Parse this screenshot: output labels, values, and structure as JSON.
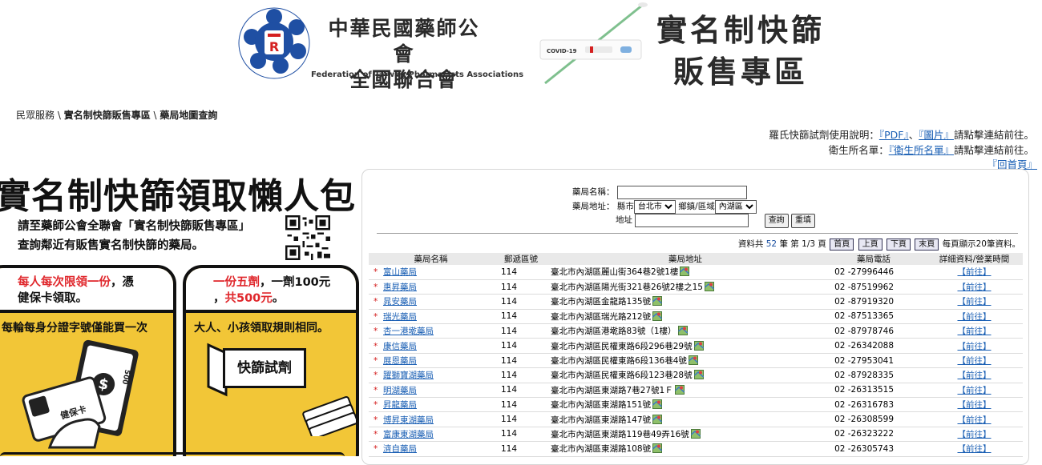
{
  "header": {
    "org_name_zh_line1": "中華民國藥師公會",
    "org_name_zh_line2": "全國聯合會",
    "org_name_en": "Federation of Taiwan Pharmacists Associations",
    "logo_ring_text": "Federation of Taiwan Pharmacists Associations",
    "swab_label": "COVID-19",
    "banner_line1": "實名制快篩",
    "banner_line2": "販售專區"
  },
  "breadcrumb": {
    "item1": "民眾服務",
    "sep": " \\ ",
    "item2": "實名制快篩販售專區",
    "item3": "藥局地圖查詢"
  },
  "info": {
    "line1_prefix": "羅氏快篩試劑使用說明：",
    "pdf_link": "『PDF』",
    "comma": "、",
    "image_link": "『圖片』",
    "line1_suffix": "請點擊連結前往。",
    "line2_prefix": "衛生所名單：",
    "clinic_link": "『衛生所名單』",
    "line2_suffix": "請點擊連結前往。",
    "home_link": "『回首頁』"
  },
  "promo": {
    "title": "實名制快篩領取懶人包",
    "desc_line1": "請至藥師公會全聯會「實名制快篩販售專區」",
    "desc_line2": "查詢鄰近有販售實名制快篩的藥局。",
    "card1_head_red": "每人每次限領一份",
    "card1_head_rest1": "，憑",
    "card1_head_line2": "健保卡領取。",
    "card1_sub": "每輪每身分證字號僅能買一次",
    "card2_head_red": "一份五劑",
    "card2_head_rest": "，一劑100元",
    "card2_head_line2_prefix": "，",
    "card2_head_line2_red": "共500元",
    "card2_head_line2_suffix": "。",
    "card2_sub": "大人、小孩領取規則相同。",
    "kit_label": "快篩試劑",
    "card_label": "健保卡",
    "bill_value": "500"
  },
  "search": {
    "name_label": "藥局名稱：",
    "name_value": "",
    "addr_label": "藥局地址：",
    "county_label": "縣市",
    "county_value": "台北市",
    "district_label": "鄉鎮/區域",
    "district_value": "內湖區",
    "street_label": "地址",
    "street_value": "",
    "query_btn": "查詢",
    "reset_btn": "重填"
  },
  "pager": {
    "prefix": "資料共",
    "total": "52",
    "unit": "筆 第",
    "page": "1/3",
    "page_unit": "頁",
    "first": "首頁",
    "prev": "上頁",
    "next": "下頁",
    "last": "末頁",
    "per_page_text": "每頁顯示20筆資料。"
  },
  "table": {
    "headers": [
      "藥局名稱",
      "郵遞區號",
      "藥局地址",
      "藥局電話",
      "詳細資料/營業時間"
    ],
    "detail_label": "【前往】",
    "rows": [
      {
        "name": "富山藥局",
        "zip": "114",
        "address": "臺北市內湖區麗山街364巷2號1樓",
        "phone": "02 -27996446"
      },
      {
        "name": "惠昇藥局",
        "zip": "114",
        "address": "臺北市內湖區陽光街321巷26號2樓之15",
        "phone": "02 -87519962"
      },
      {
        "name": "晁安藥局",
        "zip": "114",
        "address": "臺北市內湖區金龍路135號",
        "phone": "02 -87919320"
      },
      {
        "name": "瑞光藥局",
        "zip": "114",
        "address": "臺北市內湖區瑞光路212號",
        "phone": "02 -87513365"
      },
      {
        "name": "杏一港墘藥局",
        "zip": "114",
        "address": "臺北市內湖區港墘路83號（1樓）",
        "phone": "02 -87978746"
      },
      {
        "name": "康信藥局",
        "zip": "114",
        "address": "臺北市內湖區民權東路6段296巷29號",
        "phone": "02 -26342088"
      },
      {
        "name": "展恩藥局",
        "zip": "114",
        "address": "臺北市內湖區民權東路6段136巷4號",
        "phone": "02 -27953041"
      },
      {
        "name": "躍獅寶湖藥局",
        "zip": "114",
        "address": "臺北市內湖區民權東路6段123巷28號",
        "phone": "02 -87928335"
      },
      {
        "name": "明湖藥局",
        "zip": "114",
        "address": "臺北市內湖區東湖路7巷27號1Ｆ",
        "phone": "02 -26313515"
      },
      {
        "name": "昇龍藥局",
        "zip": "114",
        "address": "臺北市內湖區東湖路151號",
        "phone": "02 -26316783"
      },
      {
        "name": "博昇東湖藥局",
        "zip": "114",
        "address": "臺北市內湖區東湖路147號",
        "phone": "02 -26308599"
      },
      {
        "name": "富康東湖藥局",
        "zip": "114",
        "address": "臺北市內湖區東湖路119巷49弄16號",
        "phone": "02 -26323222"
      },
      {
        "name": "濟自藥局",
        "zip": "114",
        "address": "臺北市內湖區東湖路108號",
        "phone": "02 -26305743"
      }
    ]
  },
  "colors": {
    "logo_blue": "#1f4fa3",
    "accent_yellow": "#f2c637",
    "accent_red": "#e0282d",
    "link_blue": "#1a5fb4"
  }
}
